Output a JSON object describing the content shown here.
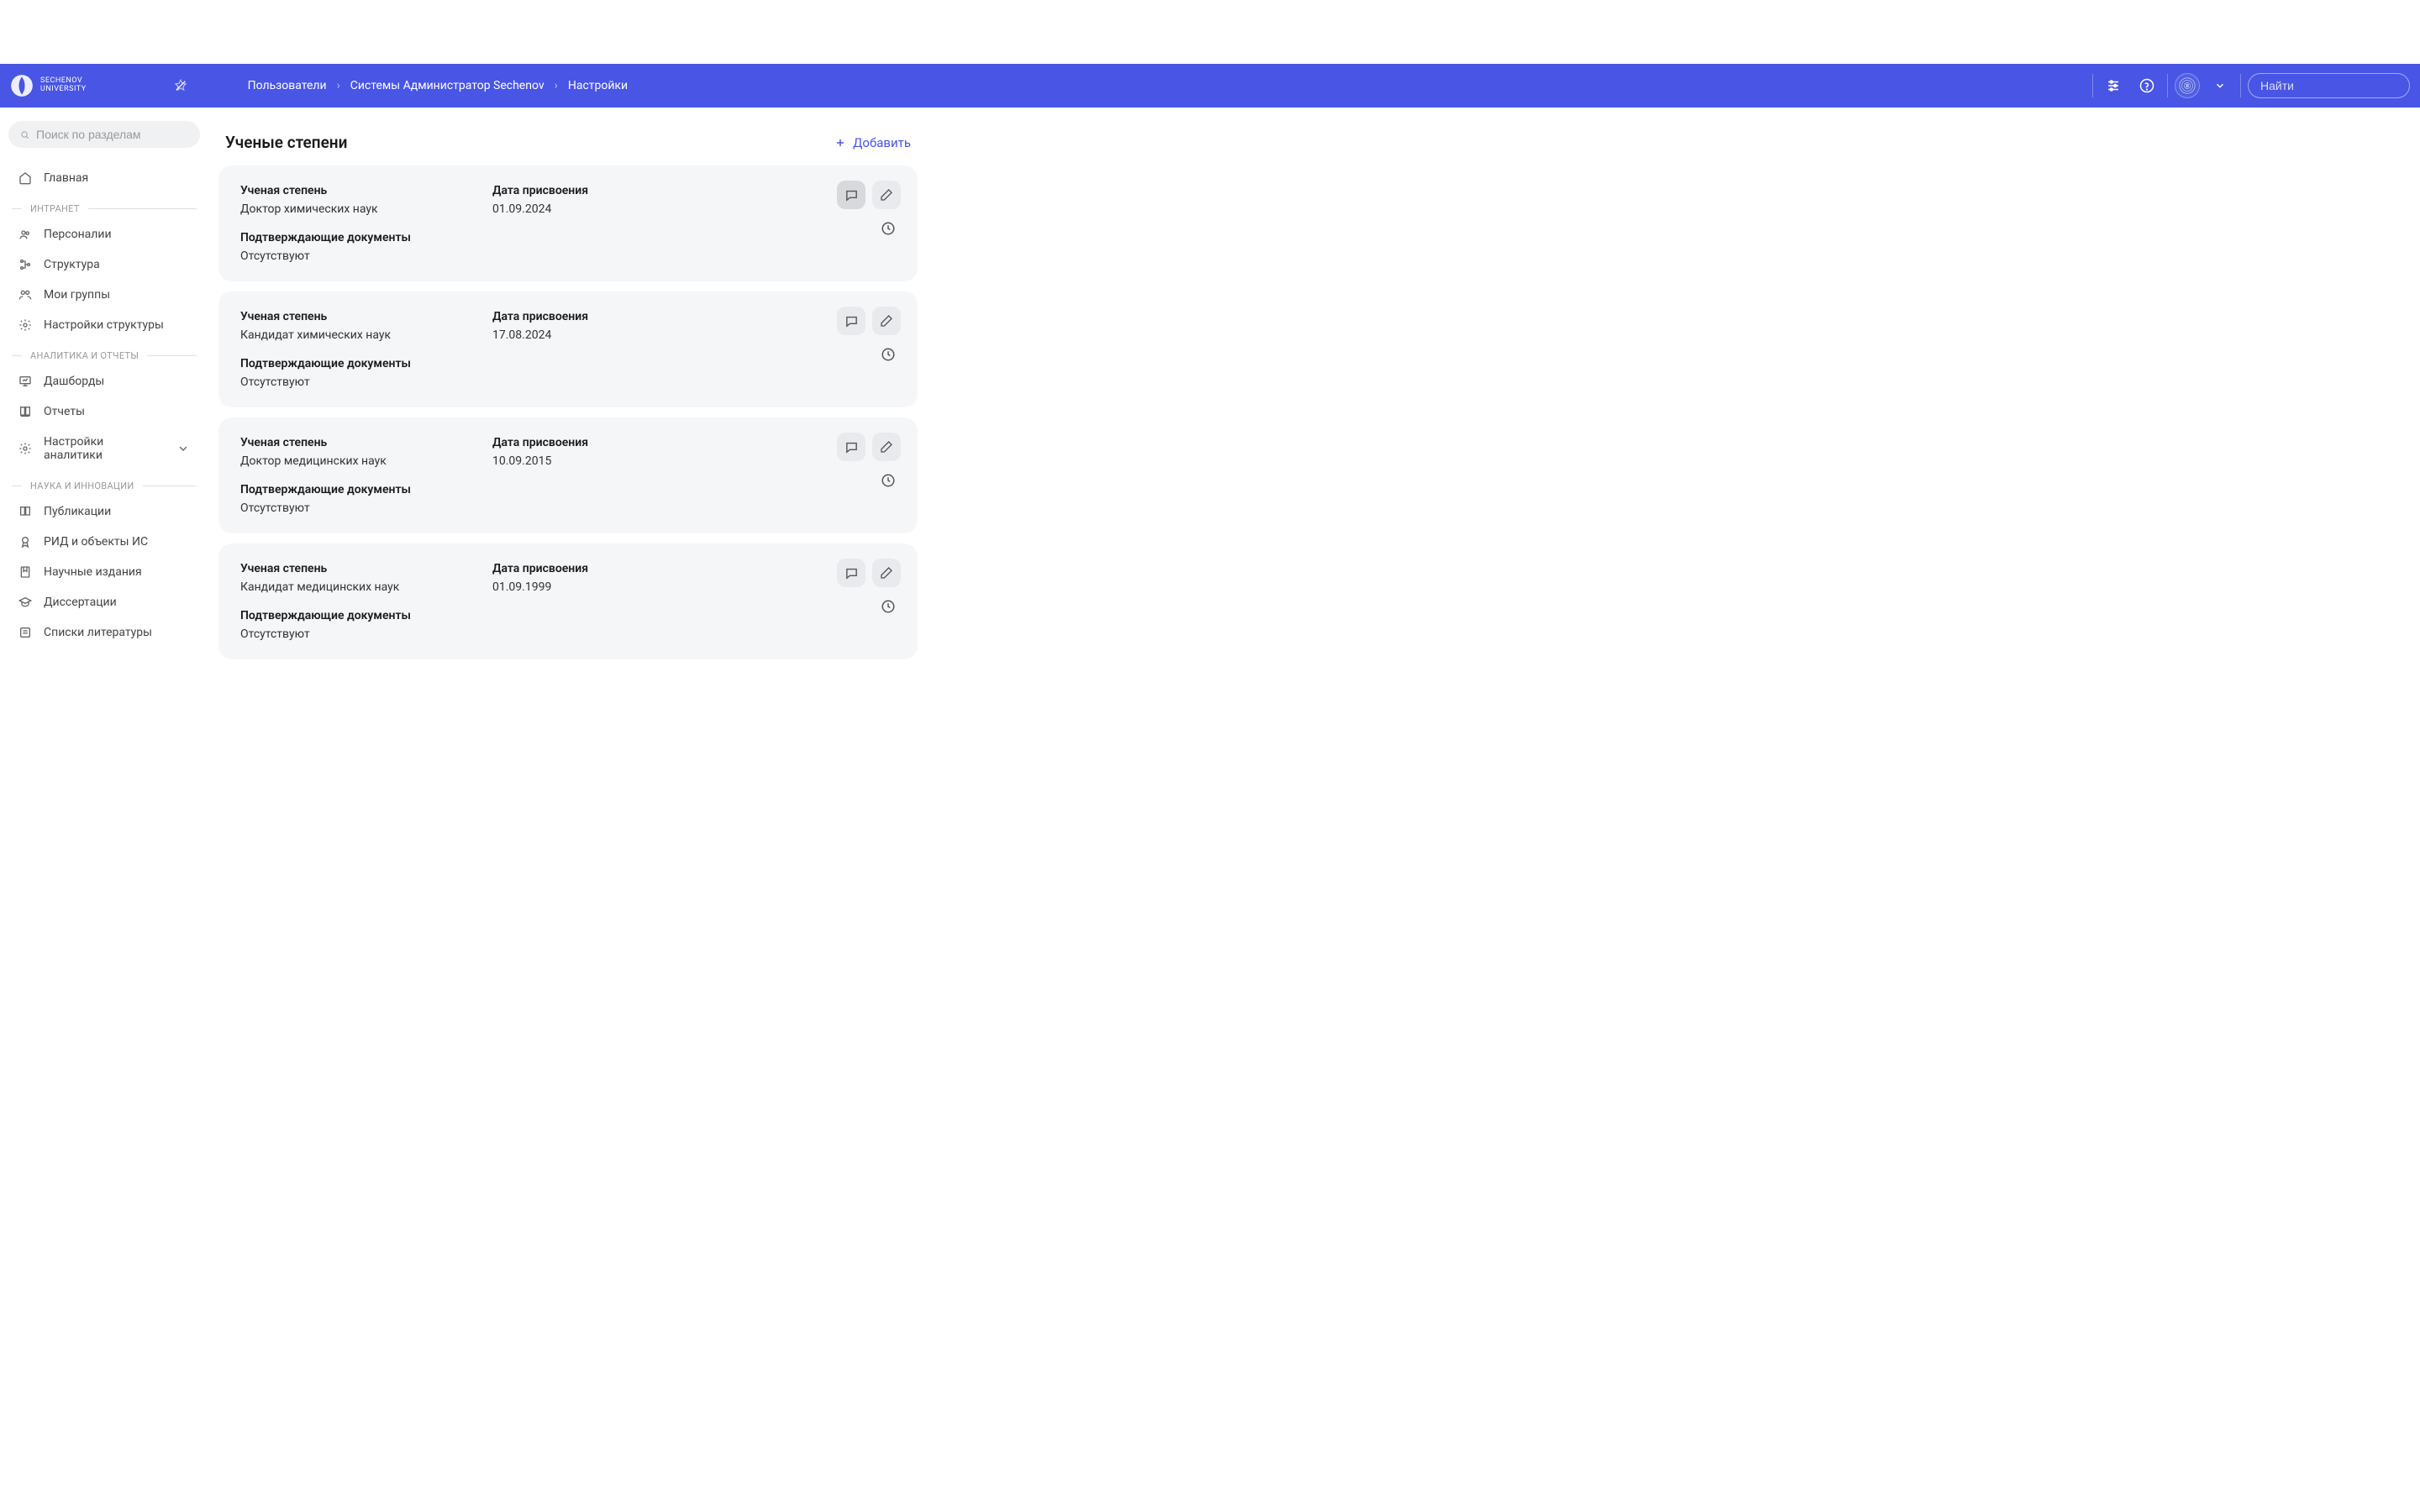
{
  "header": {
    "logo_top": "SECHENOV",
    "logo_bottom": "UNIVERSITY",
    "breadcrumb": [
      "Пользователи",
      "Системы Администратор Sechenov",
      "Настройки"
    ],
    "search_placeholder": "Найти"
  },
  "sidebar": {
    "search_placeholder": "Поиск по разделам",
    "home": "Главная",
    "groups": [
      {
        "label": "ИНТРАНЕТ",
        "items": [
          "Персоналии",
          "Структура",
          "Мои группы",
          "Настройки структуры"
        ]
      },
      {
        "label": "АНАЛИТИКА И ОТЧЕТЫ",
        "items": [
          "Дашборды",
          "Отчеты",
          "Настройки аналитики"
        ]
      },
      {
        "label": "НАУКА И ИННОВАЦИИ",
        "items": [
          "Публикации",
          "РИД и объекты ИС",
          "Научные издания",
          "Диссертации",
          "Списки литературы"
        ]
      }
    ]
  },
  "section": {
    "title": "Ученые степени",
    "add_label": "Добавить",
    "degree_label": "Ученая степень",
    "date_label": "Дата присвоения",
    "docs_label": "Подтверждающие документы",
    "docs_missing": "Отсутствуют",
    "cards": [
      {
        "degree": "Доктор химических наук",
        "date": "01.09.2024"
      },
      {
        "degree": "Кандидат химических наук",
        "date": "17.08.2024"
      },
      {
        "degree": "Доктор медицинских наук",
        "date": "10.09.2015"
      },
      {
        "degree": "Кандидат медицинских наук",
        "date": "01.09.1999"
      }
    ]
  }
}
